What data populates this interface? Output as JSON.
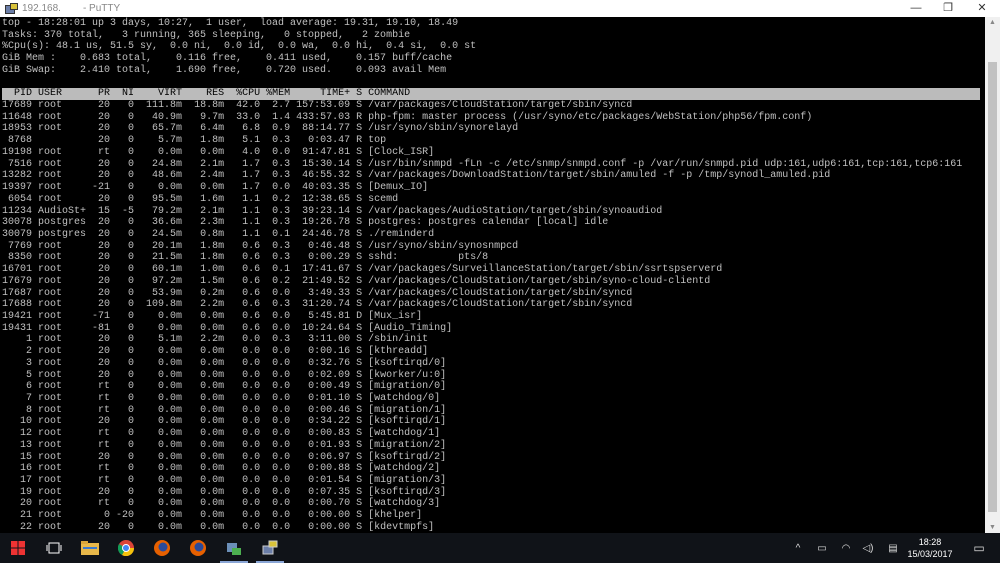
{
  "window": {
    "title_ip": "192.168.",
    "title_app": "- PuTTY",
    "minimize": "—",
    "maximize": "❐",
    "close": "✕"
  },
  "summary": [
    "top - 18:28:01 up 3 days, 10:27,  1 user,  load average: 19.31, 19.10, 18.49",
    "Tasks: 370 total,   3 running, 365 sleeping,   0 stopped,   2 zombie",
    "%Cpu(s): 48.1 us, 51.5 sy,  0.0 ni,  0.0 id,  0.0 wa,  0.0 hi,  0.4 si,  0.0 st",
    "GiB Mem :    0.683 total,    0.116 free,    0.411 used,    0.157 buff/cache",
    "GiB Swap:    2.410 total,    1.690 free,    0.720 used.    0.093 avail Mem"
  ],
  "columns": [
    "PID",
    "USER",
    "PR",
    "NI",
    "VIRT",
    "RES",
    "%CPU",
    "%MEM",
    "TIME+",
    "S",
    "COMMAND"
  ],
  "processes": [
    [
      "17689",
      "root",
      "20",
      "0",
      "111.8m",
      "18.8m",
      "42.0",
      "2.7",
      "157:53.09",
      "S",
      "/var/packages/CloudStation/target/sbin/syncd"
    ],
    [
      "11648",
      "root",
      "20",
      "0",
      "40.9m",
      "9.7m",
      "33.0",
      "1.4",
      "433:57.03",
      "R",
      "php-fpm: master process (/usr/syno/etc/packages/WebStation/php56/fpm.conf)"
    ],
    [
      "18953",
      "root",
      "20",
      "0",
      "65.7m",
      "6.4m",
      "6.8",
      "0.9",
      "88:14.77",
      "S",
      "/usr/syno/sbin/synorelayd"
    ],
    [
      "8768",
      "",
      "20",
      "0",
      "5.7m",
      "1.8m",
      "5.1",
      "0.3",
      "0:03.47",
      "R",
      "top"
    ],
    [
      "19198",
      "root",
      "rt",
      "0",
      "0.0m",
      "0.0m",
      "4.0",
      "0.0",
      "91:47.81",
      "S",
      "[Clock_ISR]"
    ],
    [
      "7516",
      "root",
      "20",
      "0",
      "24.8m",
      "2.1m",
      "1.7",
      "0.3",
      "15:30.14",
      "S",
      "/usr/bin/snmpd -fLn -c /etc/snmp/snmpd.conf -p /var/run/snmpd.pid udp:161,udp6:161,tcp:161,tcp6:161"
    ],
    [
      "13282",
      "root",
      "20",
      "0",
      "48.6m",
      "2.4m",
      "1.7",
      "0.3",
      "46:55.32",
      "S",
      "/var/packages/DownloadStation/target/sbin/amuled -f -p /tmp/synodl_amuled.pid"
    ],
    [
      "19397",
      "root",
      "-21",
      "0",
      "0.0m",
      "0.0m",
      "1.7",
      "0.0",
      "40:03.35",
      "S",
      "[Demux_IO]"
    ],
    [
      "6054",
      "root",
      "20",
      "0",
      "95.5m",
      "1.6m",
      "1.1",
      "0.2",
      "12:38.65",
      "S",
      "scemd"
    ],
    [
      "11234",
      "AudioSt+",
      "15",
      "-5",
      "79.2m",
      "2.1m",
      "1.1",
      "0.3",
      "39:23.14",
      "S",
      "/var/packages/AudioStation/target/sbin/synoaudiod"
    ],
    [
      "30078",
      "postgres",
      "20",
      "0",
      "36.6m",
      "2.3m",
      "1.1",
      "0.3",
      "19:26.78",
      "S",
      "postgres: postgres calendar [local] idle"
    ],
    [
      "30079",
      "postgres",
      "20",
      "0",
      "24.5m",
      "0.8m",
      "1.1",
      "0.1",
      "24:46.78",
      "S",
      "./reminderd"
    ],
    [
      "7769",
      "root",
      "20",
      "0",
      "20.1m",
      "1.8m",
      "0.6",
      "0.3",
      "0:46.48",
      "S",
      "/usr/syno/sbin/synosnmpcd"
    ],
    [
      "8350",
      "root",
      "20",
      "0",
      "21.5m",
      "1.8m",
      "0.6",
      "0.3",
      "0:00.29",
      "S",
      "sshd:          pts/8"
    ],
    [
      "16701",
      "root",
      "20",
      "0",
      "60.1m",
      "1.0m",
      "0.6",
      "0.1",
      "17:41.67",
      "S",
      "/var/packages/SurveillanceStation/target/sbin/ssrtspserverd"
    ],
    [
      "17679",
      "root",
      "20",
      "0",
      "97.2m",
      "1.5m",
      "0.6",
      "0.2",
      "21:49.52",
      "S",
      "/var/packages/CloudStation/target/sbin/syno-cloud-clientd"
    ],
    [
      "17687",
      "root",
      "20",
      "0",
      "53.9m",
      "0.2m",
      "0.6",
      "0.0",
      "3:49.33",
      "S",
      "/var/packages/CloudStation/target/sbin/syncd"
    ],
    [
      "17688",
      "root",
      "20",
      "0",
      "109.8m",
      "2.2m",
      "0.6",
      "0.3",
      "31:20.74",
      "S",
      "/var/packages/CloudStation/target/sbin/syncd"
    ],
    [
      "19421",
      "root",
      "-71",
      "0",
      "0.0m",
      "0.0m",
      "0.6",
      "0.0",
      "5:45.81",
      "D",
      "[Mux_isr]"
    ],
    [
      "19431",
      "root",
      "-81",
      "0",
      "0.0m",
      "0.0m",
      "0.6",
      "0.0",
      "10:24.64",
      "S",
      "[Audio_Timing]"
    ],
    [
      "1",
      "root",
      "20",
      "0",
      "5.1m",
      "2.2m",
      "0.0",
      "0.3",
      "3:11.00",
      "S",
      "/sbin/init"
    ],
    [
      "2",
      "root",
      "20",
      "0",
      "0.0m",
      "0.0m",
      "0.0",
      "0.0",
      "0:00.16",
      "S",
      "[kthreadd]"
    ],
    [
      "3",
      "root",
      "20",
      "0",
      "0.0m",
      "0.0m",
      "0.0",
      "0.0",
      "0:32.76",
      "S",
      "[ksoftirqd/0]"
    ],
    [
      "5",
      "root",
      "20",
      "0",
      "0.0m",
      "0.0m",
      "0.0",
      "0.0",
      "0:02.09",
      "S",
      "[kworker/u:0]"
    ],
    [
      "6",
      "root",
      "rt",
      "0",
      "0.0m",
      "0.0m",
      "0.0",
      "0.0",
      "0:00.49",
      "S",
      "[migration/0]"
    ],
    [
      "7",
      "root",
      "rt",
      "0",
      "0.0m",
      "0.0m",
      "0.0",
      "0.0",
      "0:01.10",
      "S",
      "[watchdog/0]"
    ],
    [
      "8",
      "root",
      "rt",
      "0",
      "0.0m",
      "0.0m",
      "0.0",
      "0.0",
      "0:00.46",
      "S",
      "[migration/1]"
    ],
    [
      "10",
      "root",
      "20",
      "0",
      "0.0m",
      "0.0m",
      "0.0",
      "0.0",
      "0:34.22",
      "S",
      "[ksoftirqd/1]"
    ],
    [
      "12",
      "root",
      "rt",
      "0",
      "0.0m",
      "0.0m",
      "0.0",
      "0.0",
      "0:00.83",
      "S",
      "[watchdog/1]"
    ],
    [
      "13",
      "root",
      "rt",
      "0",
      "0.0m",
      "0.0m",
      "0.0",
      "0.0",
      "0:01.93",
      "S",
      "[migration/2]"
    ],
    [
      "15",
      "root",
      "20",
      "0",
      "0.0m",
      "0.0m",
      "0.0",
      "0.0",
      "0:06.97",
      "S",
      "[ksoftirqd/2]"
    ],
    [
      "16",
      "root",
      "rt",
      "0",
      "0.0m",
      "0.0m",
      "0.0",
      "0.0",
      "0:00.88",
      "S",
      "[watchdog/2]"
    ],
    [
      "17",
      "root",
      "rt",
      "0",
      "0.0m",
      "0.0m",
      "0.0",
      "0.0",
      "0:01.54",
      "S",
      "[migration/3]"
    ],
    [
      "19",
      "root",
      "20",
      "0",
      "0.0m",
      "0.0m",
      "0.0",
      "0.0",
      "0:07.35",
      "S",
      "[ksoftirqd/3]"
    ],
    [
      "20",
      "root",
      "rt",
      "0",
      "0.0m",
      "0.0m",
      "0.0",
      "0.0",
      "0:00.70",
      "S",
      "[watchdog/3]"
    ],
    [
      "21",
      "root",
      "0",
      "-20",
      "0.0m",
      "0.0m",
      "0.0",
      "0.0",
      "0:00.00",
      "S",
      "[khelper]"
    ],
    [
      "22",
      "root",
      "20",
      "0",
      "0.0m",
      "0.0m",
      "0.0",
      "0.0",
      "0:00.00",
      "S",
      "[kdevtmpfs]"
    ]
  ],
  "taskbar": {
    "apps": [
      "start",
      "task-view",
      "file-explorer",
      "chrome",
      "firefox",
      "firefox",
      "network-tool",
      "putty"
    ],
    "tray": {
      "chevron": "^",
      "time": "18:28",
      "date": "15/03/2017"
    }
  }
}
